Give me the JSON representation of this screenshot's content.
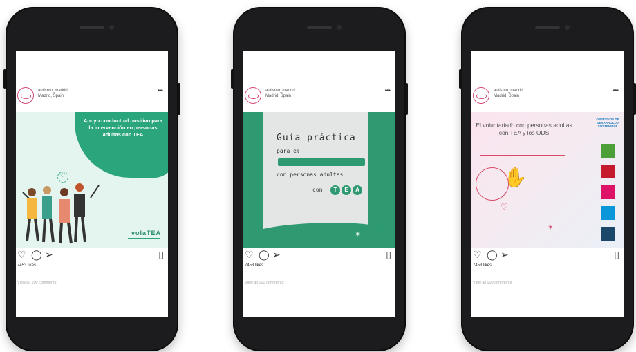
{
  "posts": [
    {
      "username": "autismo_madrid",
      "location": "Madrid, Spain",
      "more": "•••",
      "image_title": "Apoyo conductual positivo para la intervención en personas adultas con TEA",
      "image_logo": "volaTEA",
      "likes": "7453 likes",
      "comments": "View all 100 comments"
    },
    {
      "username": "autismo_madrid",
      "location": "Madrid, Spain",
      "more": "•••",
      "image_line1": "Guía práctica",
      "image_line2": "para el",
      "image_line3": "con personas adultas",
      "image_line4": "con",
      "image_line4_letters": [
        "T",
        "E",
        "A"
      ],
      "likes": "7453 likes",
      "comments": "View all 100 comments"
    },
    {
      "username": "autismo_madrid",
      "location": "Madrid, Spain",
      "more": "•••",
      "image_title": "El voluntariado con personas adultas con TEA y los ODS",
      "sdg_heading": "OBJETIVOS DE DESARROLLO SOSTENIBLE",
      "sdg_colors": [
        "#4c9f38",
        "#c5192d",
        "#dd1367",
        "#0a97d9",
        "#19486a"
      ],
      "likes": "7453 likes",
      "comments": "View all 100 comments"
    }
  ],
  "icons": {
    "like": "heart-icon",
    "comment": "comment-icon",
    "share": "send-icon",
    "save": "bookmark-icon"
  },
  "colors": {
    "brand_green": "#2aa57c",
    "brand_pink": "#d94a6a",
    "phone_body": "#1c1c1e"
  }
}
